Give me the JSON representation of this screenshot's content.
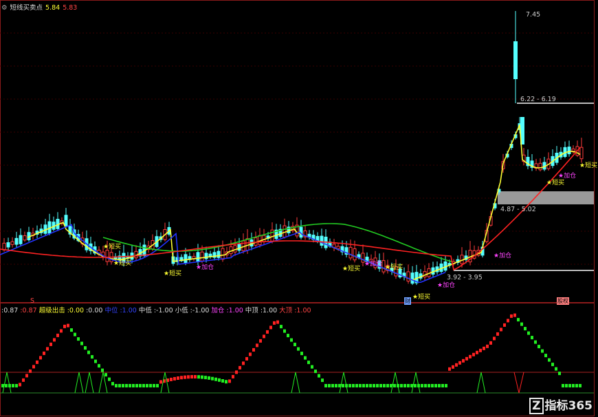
{
  "header": {
    "title": "短线买卖点",
    "v1": "5.84",
    "v2": "5.83"
  },
  "colors": {
    "up": "#ff3c3c",
    "down": "#54ffff",
    "ma_fast": "#ffff33",
    "ma_mid": "#2233ff",
    "ma_slow": "#22cc22",
    "ma_red": "#ff2222",
    "signal_buy": "#ffff33",
    "signal_add": "#ff44ff"
  },
  "price_labels": {
    "high": "7.45",
    "range1": "6.22 - 6.19",
    "range2": "4.87 - 5.02",
    "range3": "3.92 - 3.95"
  },
  "signals": {
    "buy": "★短买",
    "add": "★加仓"
  },
  "bottom_boxes": {
    "left": "财",
    "right": "股权"
  },
  "left_marker": "S",
  "indicator_header": {
    "v0": ":0.87",
    "v1": ":0.87",
    "name": "超级出击",
    "a": ":0.00",
    "b": ":0.00",
    "c_label": "中位",
    "c_val": ":1.00",
    "d_label": "中低",
    "d_val": ":-1.00",
    "e_label": "小低",
    "e_val": ":-1.00",
    "f_label": "加仓",
    "f_val": ":1.00",
    "g_label": "中顶",
    "g_val": ":1.00",
    "h_label": "大顶",
    "h_val": ":1.00"
  },
  "logo": "指标365"
}
